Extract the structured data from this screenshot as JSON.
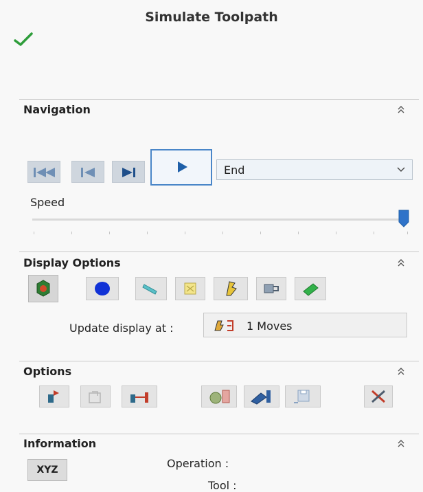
{
  "panel": {
    "title": "Simulate Toolpath",
    "ok_icon": "checkmark-icon"
  },
  "navigation": {
    "title": "Navigation",
    "buttons": [
      "go-to-start-icon",
      "step-back-icon",
      "step-forward-icon",
      "play-icon"
    ],
    "mode_value": "End",
    "speed_label": "Speed",
    "speed_level": 1.0
  },
  "display_options": {
    "title": "Display Options",
    "buttons": [
      "stock-display-icon",
      "sphere-display-icon",
      "tool-display-icon",
      "holder-display-icon",
      "toolpath-display-icon",
      "machine-display-icon",
      "cutter-display-icon"
    ],
    "update_label": "Update display at :",
    "update_value": "1 Moves"
  },
  "options": {
    "title": "Options",
    "buttons": [
      "option-stock-icon",
      "option-disabled-icon",
      "option-compare-icon",
      "option-gouge-icon",
      "option-machine-icon",
      "option-save-icon",
      "option-tools-icon"
    ]
  },
  "information": {
    "title": "Information",
    "xyz_label": "XYZ",
    "operation_label": "Operation :",
    "tool_label": "Tool :"
  },
  "colors": {
    "accent": "#4a86c8",
    "check": "#2e9d3a",
    "blue_icon": "#1f5fa8"
  }
}
